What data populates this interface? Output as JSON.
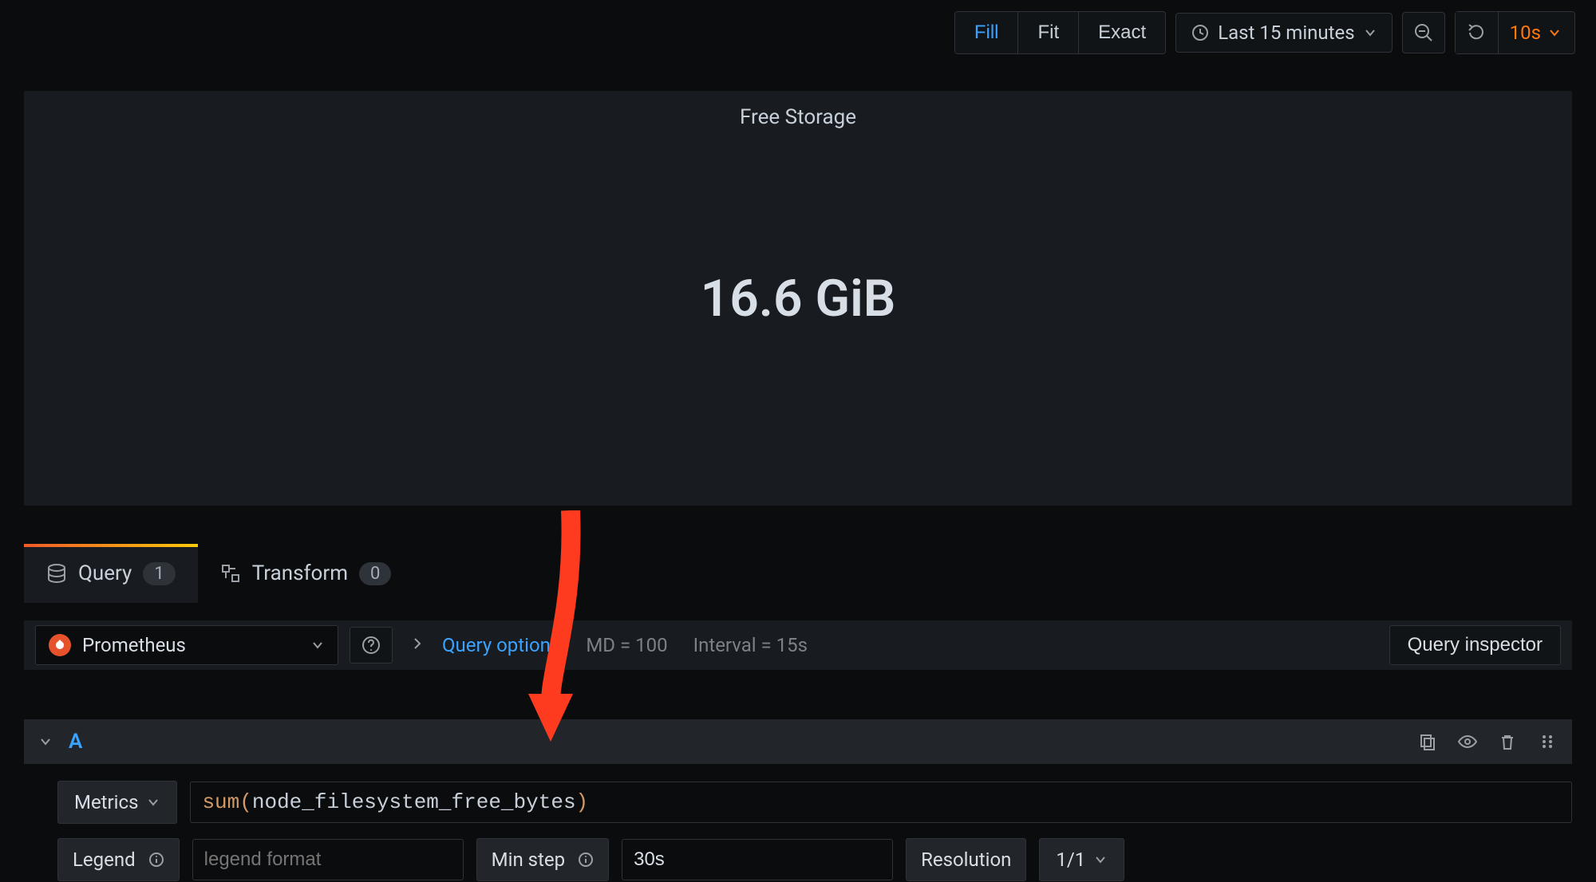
{
  "toolbar": {
    "fit_modes": {
      "fill": "Fill",
      "fit": "Fit",
      "exact": "Exact",
      "active": "fill"
    },
    "time_range": "Last 15 minutes",
    "refresh_interval": "10s"
  },
  "panel": {
    "title": "Free Storage",
    "value": "16.6 GiB"
  },
  "tabs": {
    "query": {
      "label": "Query",
      "count": "1"
    },
    "transform": {
      "label": "Transform",
      "count": "0"
    }
  },
  "datasource": {
    "name": "Prometheus",
    "options_label": "Query options",
    "md": "MD = 100",
    "interval": "Interval = 15s",
    "inspector": "Query inspector"
  },
  "query_row": {
    "letter": "A",
    "metrics_label": "Metrics",
    "expr_fn": "sum",
    "expr_body": "node_filesystem_free_bytes"
  },
  "options_row": {
    "legend_label": "Legend",
    "legend_placeholder": "legend format",
    "minstep_label": "Min step",
    "minstep_value": "30s",
    "resolution_label": "Resolution",
    "resolution_value": "1/1"
  }
}
